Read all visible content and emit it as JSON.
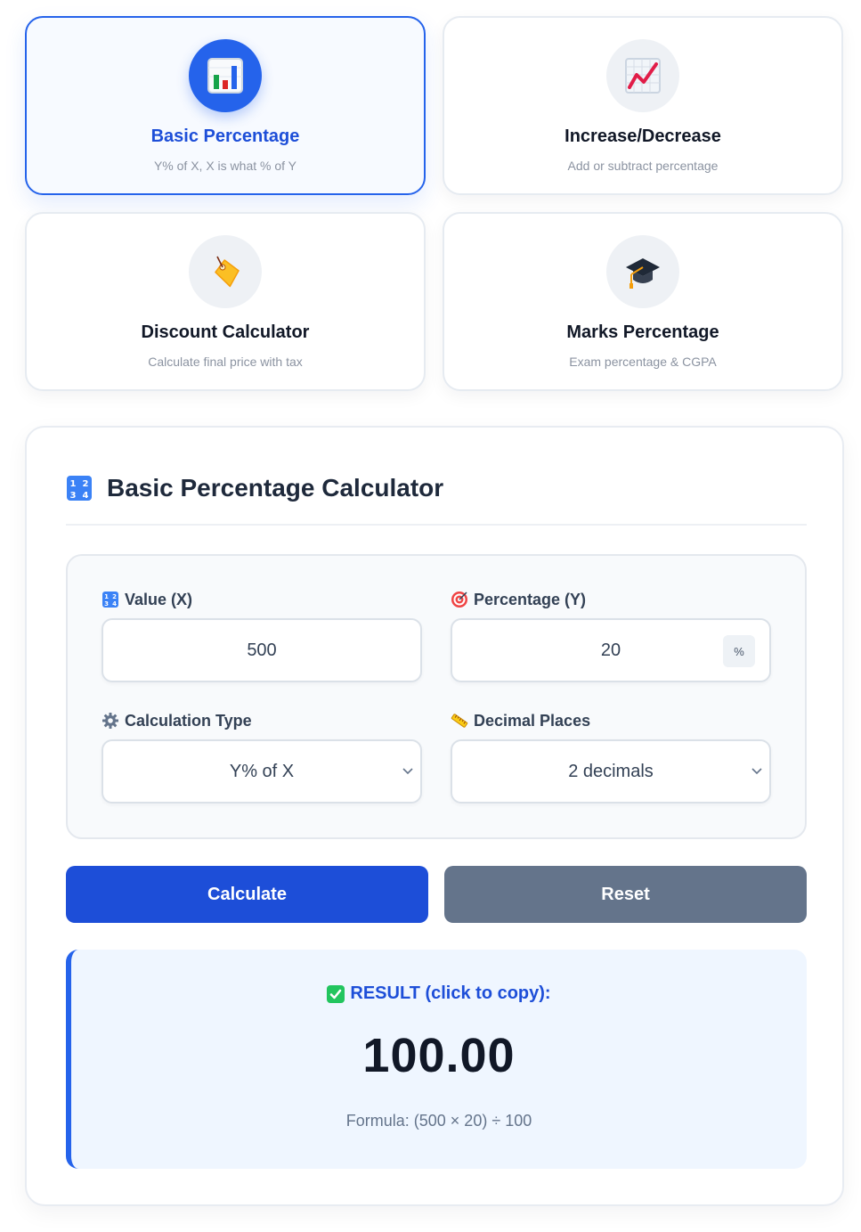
{
  "mode_cards": [
    {
      "title": "Basic Percentage",
      "subtitle": "Y% of X, X is what % of Y",
      "icon": "bar-chart-icon",
      "active": true
    },
    {
      "title": "Increase/Decrease",
      "subtitle": "Add or subtract percentage",
      "icon": "trending-chart-icon",
      "active": false
    },
    {
      "title": "Discount Calculator",
      "subtitle": "Calculate final price with tax",
      "icon": "price-tag-icon",
      "active": false
    },
    {
      "title": "Marks Percentage",
      "subtitle": "Exam percentage & CGPA",
      "icon": "graduation-cap-icon",
      "active": false
    }
  ],
  "calculator": {
    "title": "Basic Percentage Calculator",
    "title_icon": "numbers-icon",
    "value_x": {
      "label": "Value (X)",
      "value": "500",
      "icon": "numbers-icon"
    },
    "percentage_y": {
      "label": "Percentage (Y)",
      "value": "20",
      "suffix": "%",
      "icon": "target-icon"
    },
    "calc_type": {
      "label": "Calculation Type",
      "selected": "Y% of X",
      "icon": "gear-icon"
    },
    "decimals": {
      "label": "Decimal Places",
      "selected": "2 decimals",
      "icon": "ruler-icon"
    },
    "calculate_label": "Calculate",
    "reset_label": "Reset"
  },
  "result": {
    "label": "RESULT (click to copy):",
    "value": "100.00",
    "formula": "Formula: (500 × 20) ÷ 100"
  },
  "colors": {
    "accent": "#2563eb",
    "calculate_button": "#1d4ed8",
    "reset_button": "#64748b",
    "result_background": "#eff6ff"
  }
}
